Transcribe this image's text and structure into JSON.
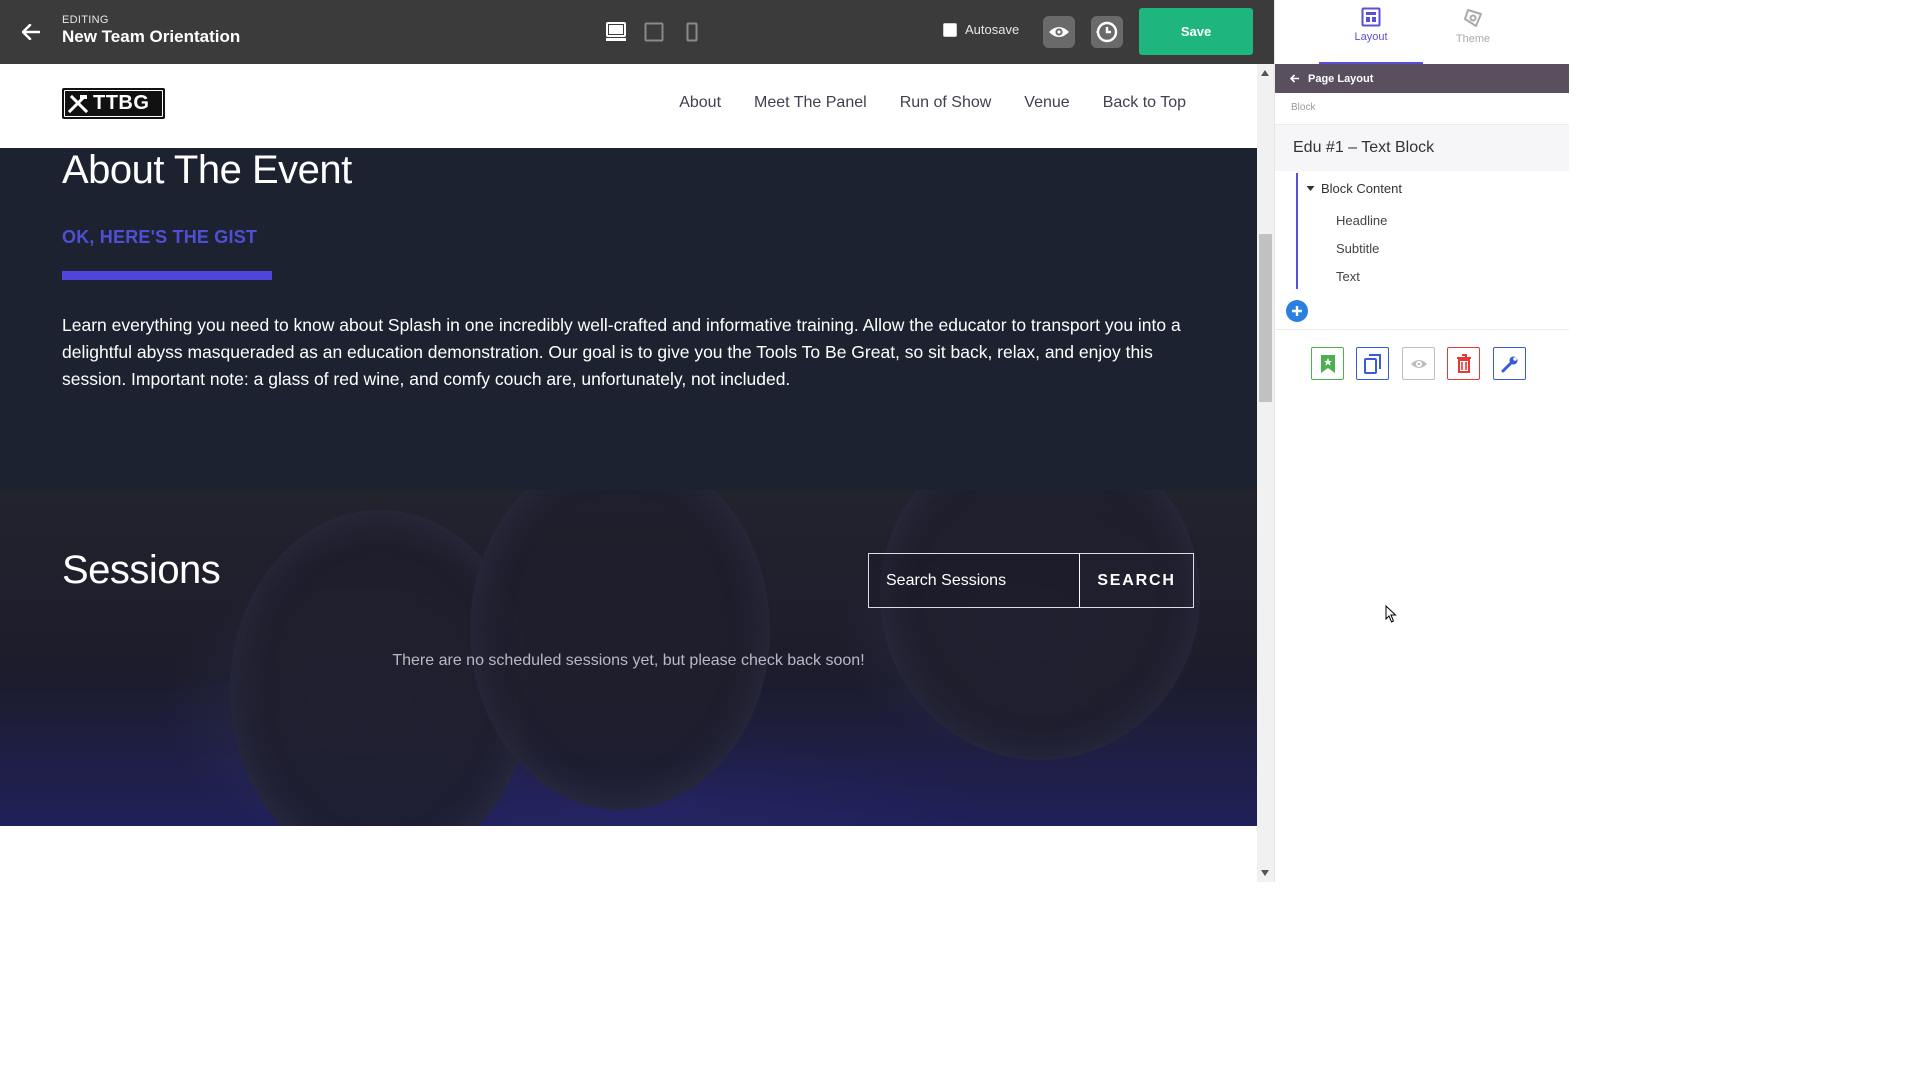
{
  "editor": {
    "mode_label": "EDITING",
    "title": "New Team Orientation",
    "autosave_label": "Autosave",
    "save_label": "Save"
  },
  "site": {
    "logo_text": "TTBG",
    "nav": [
      "About",
      "Meet The Panel",
      "Run of Show",
      "Venue",
      "Back to Top"
    ]
  },
  "about": {
    "title": "About The Event",
    "subtitle": "OK, HERE'S THE GIST",
    "text": "Learn everything you need to know about Splash in one incredibly well-crafted and informative training. Allow the educator to transport you into a delightful abyss masqueraded as an education demonstration. Our goal is to give you the Tools To Be Great, so sit back, relax, and enjoy this session. Important note: a glass of red wine, and comfy couch are, unfortunately, not included."
  },
  "sessions": {
    "title": "Sessions",
    "search_placeholder": "Search Sessions",
    "search_button": "SEARCH",
    "empty_message": "There are no scheduled sessions yet, but please check back soon!"
  },
  "panel": {
    "tabs": {
      "layout": "Layout",
      "theme": "Theme"
    },
    "breadcrumb": "Page Layout",
    "section_label": "Block",
    "block_title": "Edu #1 – Text Block",
    "tree_head": "Block Content",
    "tree_items": [
      "Headline",
      "Subtitle",
      "Text"
    ]
  },
  "colors": {
    "accent": "#5b4fd8",
    "save_green": "#1fb57e",
    "dark_section": "#1d2231",
    "subtitle_purple": "#4f4fd6"
  }
}
